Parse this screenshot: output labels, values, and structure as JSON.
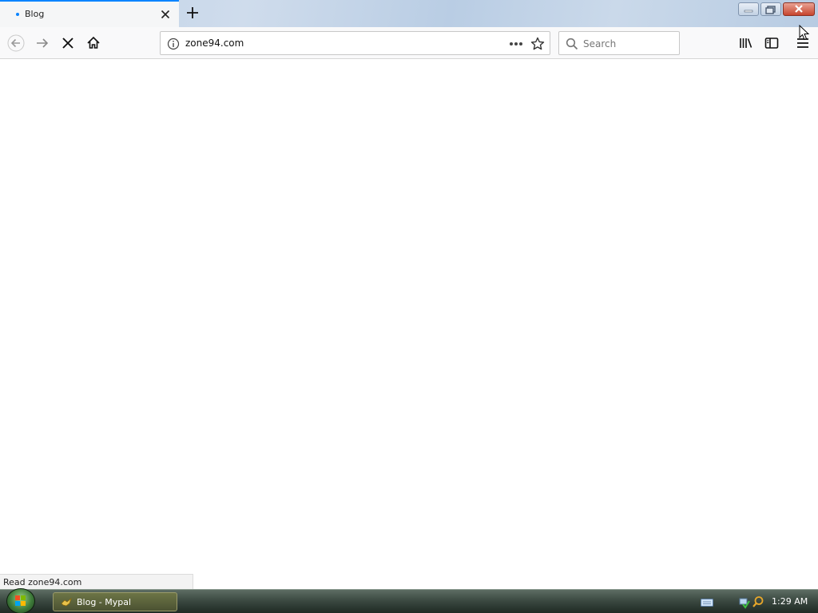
{
  "browser": {
    "tab": {
      "title": "Blog",
      "loading_indicator_color": "#0a84ff"
    },
    "newtab_icon": "plus-icon",
    "window_controls": [
      "minimize-icon",
      "restore-icon",
      "close-icon"
    ],
    "nav": {
      "back_icon": "arrow-left-icon",
      "forward_icon": "arrow-right-icon",
      "stop_icon": "close-icon",
      "home_icon": "home-icon"
    },
    "urlbar": {
      "url": "zone94.com",
      "info_icon": "info-icon",
      "more_icon": "ellipsis-icon",
      "bookmark_icon": "star-icon"
    },
    "search": {
      "placeholder": "Search",
      "icon": "search-icon"
    },
    "toolbar_icons": [
      "library-icon",
      "sidebar-icon",
      "hamburger-menu-icon"
    ]
  },
  "status": {
    "text": "Read zone94.com"
  },
  "taskbar": {
    "task_label": "Blog - Mypal",
    "clock": "1:29 AM",
    "tray_icons": [
      "keyboard-icon",
      "network-icon",
      "search-icon"
    ]
  },
  "colors": {
    "accent": "#0a84ff",
    "page_background": "#ffffff"
  }
}
